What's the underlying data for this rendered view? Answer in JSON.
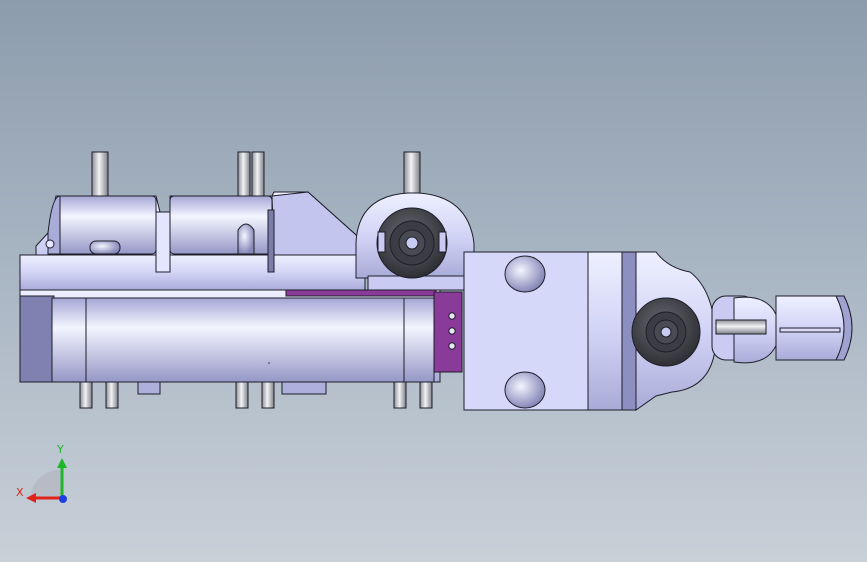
{
  "viewport": {
    "background_top": "#8d9cac",
    "background_bottom": "#c8d0d8"
  },
  "model": {
    "body_color": "#c9cbf2",
    "shade_color": "#9a9ccc",
    "edge_color": "#1e1e2a",
    "accent_plate_color": "#8a3a98",
    "pin_color": "#bfc2c8"
  },
  "triad": {
    "x_label": "X",
    "y_label": "Y",
    "x_color": "#e0241c",
    "y_color": "#1fb62a",
    "z_color": "#1c3fe0"
  }
}
